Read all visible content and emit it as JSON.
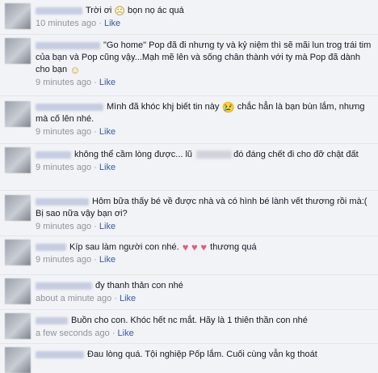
{
  "comments": [
    {
      "text": "Trời ơi",
      "emoji": "☹",
      "text2": " bọn nọ ác quá",
      "time": "10 minutes ago",
      "like": "Like"
    },
    {
      "text": "\"Go home\" Pop đã đi nhưng ty và kỷ niệm thì sẽ mãi lun trog trái tim của bạn và Pop cũng vậy...Mạh mẽ lên và sống chân thành với ty mà Pop đã dành cho bạn",
      "emoji": "☺",
      "time": "9 minutes ago",
      "like": "Like"
    },
    {
      "text": "Mình đã khóc khj biết tin này",
      "emoji": "😢",
      "text2": " chắc hẳn là bạn bùn lắm, nhưng mà cố lên nhé.",
      "time": "9 minutes ago",
      "like": "Like"
    },
    {
      "text": "không thể cầm lòng được... lũ",
      "text2": "đó đáng chết đi cho đỡ chật đất",
      "time": "9 minutes ago",
      "like": "Like"
    },
    {
      "text": "Hôm bữa thấy bé về được nhà và có hình bé lành vết thương rồi mà:( Bị sao nữa vậy bạn ơi?",
      "time": "9 minutes ago",
      "like": "Like"
    },
    {
      "text": "Kíp sau làm người con nhé.",
      "hearts": "♥ ♥ ♥",
      "text2": " thương quá",
      "time": "9 minutes ago",
      "like": "Like"
    },
    {
      "text": "đy thanh thản con nhé",
      "time": "about a minute ago",
      "like": "Like"
    },
    {
      "text": "Buồn cho con. Khóc hết nc mắt. Hãy là 1 thiên thần con nhé",
      "time": "a few seconds ago",
      "like": "Like"
    },
    {
      "text": "Đau lòng quá. Tội nghiệp Pốp lắm. Cuối cùng vẫn kg thoát"
    }
  ]
}
